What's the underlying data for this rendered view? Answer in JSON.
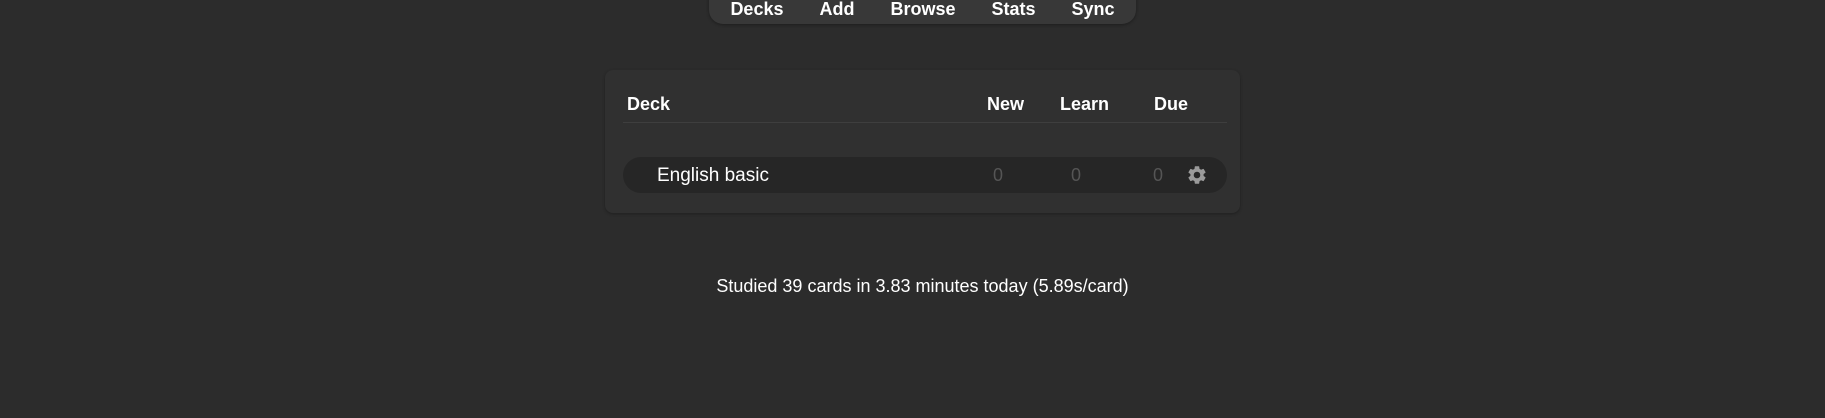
{
  "toolbar": {
    "links": [
      "Decks",
      "Add",
      "Browse",
      "Stats",
      "Sync"
    ]
  },
  "deck_table": {
    "headers": {
      "deck": "Deck",
      "new": "New",
      "learn": "Learn",
      "due": "Due"
    },
    "rows": [
      {
        "name": "English basic",
        "new": "0",
        "learn": "0",
        "due": "0",
        "options_icon": "gear-icon"
      }
    ]
  },
  "study_summary": "Studied 39 cards in 3.83 minutes today (5.89s/card)",
  "colors": {
    "background": "#2c2c2c",
    "panel": "#303030",
    "row": "#262626",
    "zero_count": "#555555",
    "text": "#ffffff"
  }
}
